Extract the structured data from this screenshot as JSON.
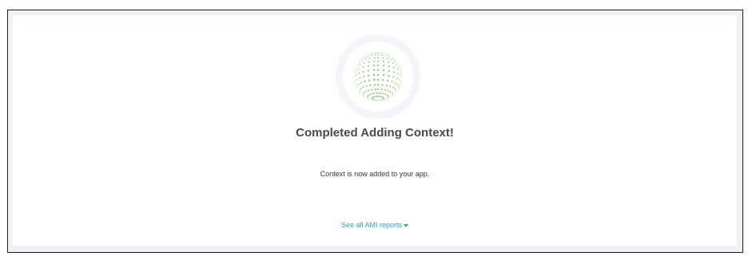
{
  "status": {
    "title": "Completed Adding Context!",
    "message": "Context is now added to your app.",
    "icon": "dotted-globe-icon",
    "icon_color": "#5bb52f"
  },
  "footer": {
    "reports_link": "See all AMI reports"
  }
}
